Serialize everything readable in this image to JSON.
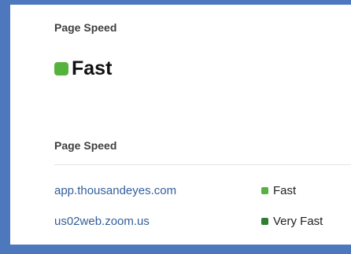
{
  "summary": {
    "label": "Page Speed",
    "status": "Fast",
    "color": "#55b33d"
  },
  "table": {
    "label": "Page Speed",
    "rows": [
      {
        "host": "app.thousandeyes.com",
        "status": "Fast",
        "color": "#55b33d"
      },
      {
        "host": "us02web.zoom.us",
        "status": "Very Fast",
        "color": "#2e7d32"
      }
    ]
  }
}
